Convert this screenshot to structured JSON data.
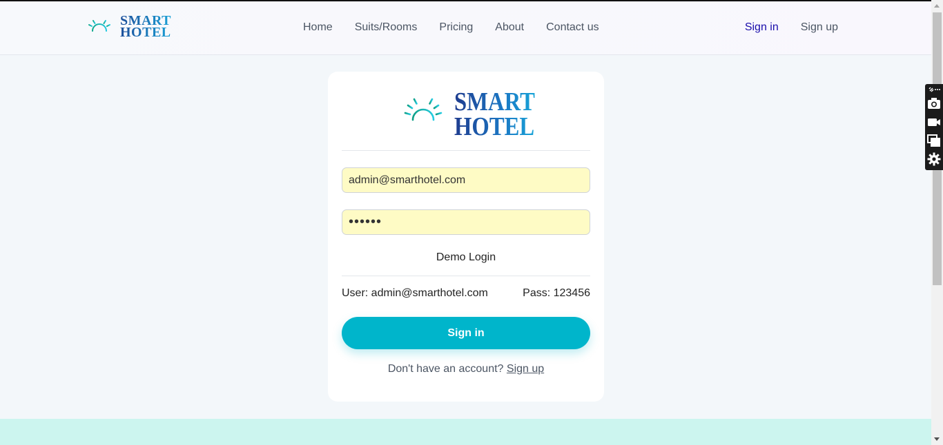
{
  "brand": {
    "line1": "SMART",
    "line2": "HOTEL"
  },
  "nav": {
    "items": [
      "Home",
      "Suits/Rooms",
      "Pricing",
      "About",
      "Contact us"
    ]
  },
  "auth": {
    "sign_in": "Sign in",
    "sign_up": "Sign up"
  },
  "login": {
    "email_value": "admin@smarthotel.com",
    "password_value": "123456",
    "demo_label": "Demo Login",
    "demo_user": "User: admin@smarthotel.com",
    "demo_pass": "Pass: 123456",
    "submit_label": "Sign in",
    "footer_text": "Don't have an account?",
    "footer_link": "Sign up"
  },
  "colors": {
    "accent": "#00b5cb",
    "field_bg": "#fefbc5",
    "page_bg": "#f3f7fa",
    "band": "#ccf5ef",
    "brand_dark": "#1e3c8f",
    "brand_light": "#18a4d8"
  },
  "sidebar_tools": [
    "attach-icon",
    "more-icon",
    "camera-icon",
    "video-icon",
    "windows-icon",
    "gear-icon"
  ]
}
